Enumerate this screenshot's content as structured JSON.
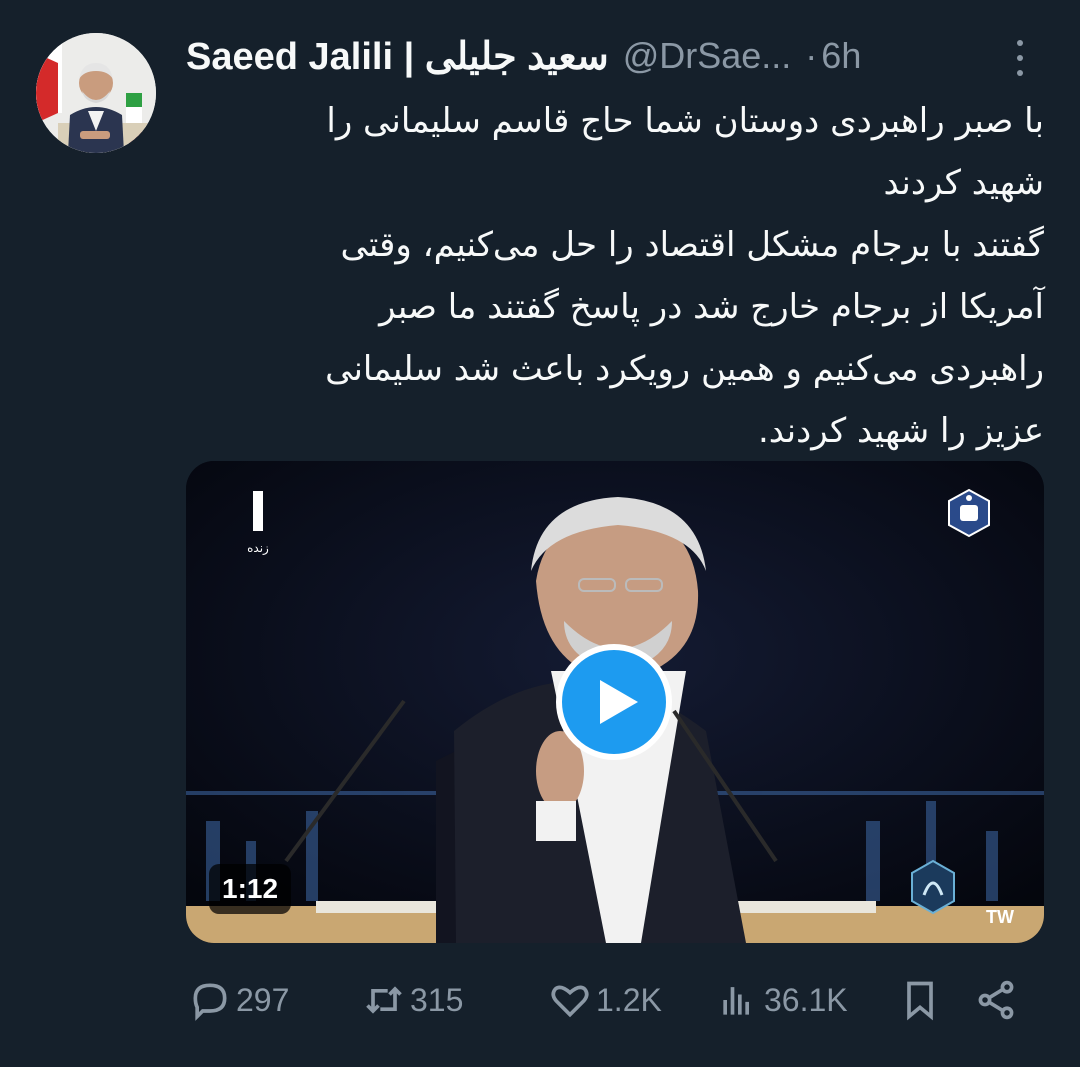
{
  "author": {
    "display_name": "Saeed Jalili | سعید جلیلی",
    "handle": "@DrSae...",
    "separator": "·",
    "timestamp": "6h",
    "avatar_icon": "user-avatar"
  },
  "tweet": {
    "lines": [
      "با صبر راهبردی دوستان شما حاج قاسم سلیمانی را",
      "شهید کردند",
      "گفتند با برجام مشکل اقتصاد را حل می‌کنیم، وقتی",
      "آمریکا از برجام خارج شد در پاسخ گفتند ما صبر",
      "راهبردی می‌کنیم و همین رویکرد باعث شد سلیمانی",
      "عزیز را شهید کردند."
    ]
  },
  "media": {
    "type": "video",
    "duration": "1:12",
    "live_label": "زنده",
    "watermark": "TW",
    "play_icon": "play-icon"
  },
  "actions": {
    "reply_count": "297",
    "retweet_count": "315",
    "like_count": "1.2K",
    "view_count": "36.1K"
  },
  "colors": {
    "background": "#15202b",
    "text_primary": "#f7f9f9",
    "text_secondary": "#8b98a5",
    "accent": "#1d9bf0"
  }
}
